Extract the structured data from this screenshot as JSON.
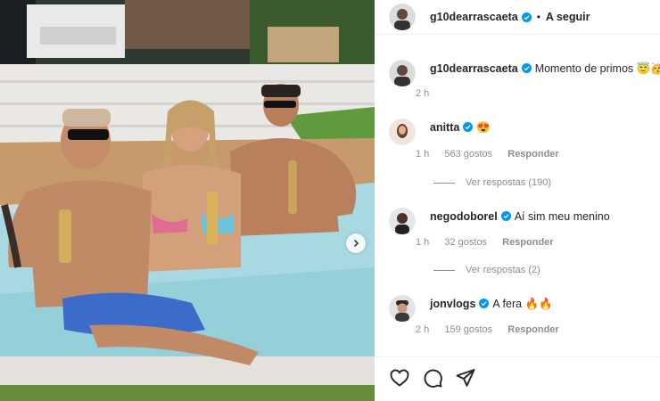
{
  "post": {
    "author": "g10dearrascaeta",
    "follow_label": "A seguir",
    "caption": "Momento de primos 😇🥳",
    "caption_time": "2 h"
  },
  "comments": [
    {
      "user": "anitta",
      "text": "😍",
      "time": "1 h",
      "likes": "563 gostos",
      "reply_label": "Responder",
      "view_replies": "Ver respostas (190)"
    },
    {
      "user": "negodoborel",
      "text": "Aí sim meu menino",
      "time": "1 h",
      "likes": "32 gostos",
      "reply_label": "Responder",
      "view_replies": "Ver respostas (2)"
    },
    {
      "user": "jonvlogs",
      "text": "A fera 🔥🔥",
      "time": "2 h",
      "likes": "159 gostos",
      "reply_label": "Responder"
    }
  ],
  "icons": {
    "verified": "verified-badge-icon",
    "like": "heart-icon",
    "comment": "comment-icon",
    "share": "paper-plane-icon",
    "next": "chevron-right-icon"
  },
  "colors": {
    "verified_blue": "#0095f6",
    "meta_gray": "#8e8e8e",
    "text": "#262626"
  }
}
